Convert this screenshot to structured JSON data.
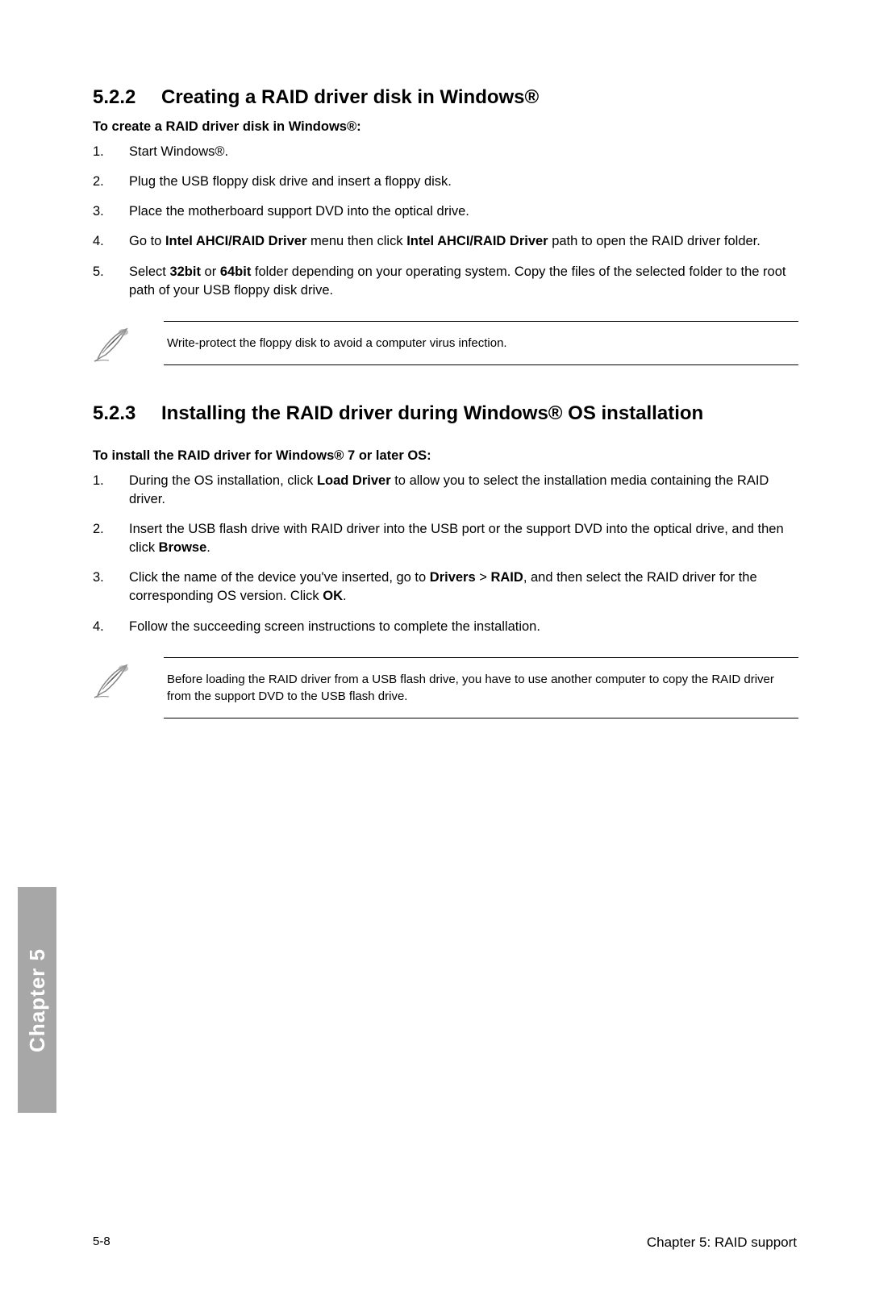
{
  "section1": {
    "number": "5.2.2",
    "title": "Creating a RAID driver disk in Windows®",
    "intro": "To create a RAID driver disk in Windows®:",
    "steps": [
      "Start Windows®.",
      "Plug the USB floppy disk drive and insert a floppy disk.",
      "Place the motherboard support DVD into the optical drive.",
      {
        "pre": "Go to ",
        "b1": "Intel AHCI/RAID Driver",
        "mid": " menu then click ",
        "b2": "Intel AHCI/RAID Driver",
        "post": " path to open the RAID driver folder."
      },
      {
        "pre": "Select ",
        "b1": "32bit",
        "mid": " or ",
        "b2": "64bit",
        "post": " folder depending on your operating system. Copy the files of the selected folder to the root path of your USB floppy disk drive."
      }
    ],
    "note": "Write-protect the floppy disk to avoid a computer virus infection."
  },
  "section2": {
    "number": "5.2.3",
    "title": "Installing the RAID driver during Windows® OS installation",
    "intro": "To install the RAID driver for Windows® 7 or later OS:",
    "steps": [
      {
        "pre": "During the OS installation, click ",
        "b1": "Load Driver",
        "post": " to allow you to select the installation media containing the RAID driver."
      },
      {
        "pre": "Insert the USB flash drive with RAID driver into the USB port or the support DVD into the optical drive, and then click ",
        "b1": "Browse",
        "post": "."
      },
      {
        "pre": "Click the name of the device you've inserted, go to ",
        "b1": "Drivers",
        "gt": " > ",
        "b2": "RAID",
        "mid2": ", and then select the RAID driver for the corresponding OS version. Click ",
        "b3": "OK",
        "post": "."
      },
      "Follow the succeeding screen instructions to complete the installation."
    ],
    "note": "Before loading the RAID driver from a USB flash drive, you have to use another computer to copy the RAID driver from the support DVD to the USB flash drive."
  },
  "sidebar": "Chapter 5",
  "footer_left": "5-8",
  "footer_right": "Chapter 5: RAID support",
  "markers": [
    "1.",
    "2.",
    "3.",
    "4.",
    "5."
  ]
}
